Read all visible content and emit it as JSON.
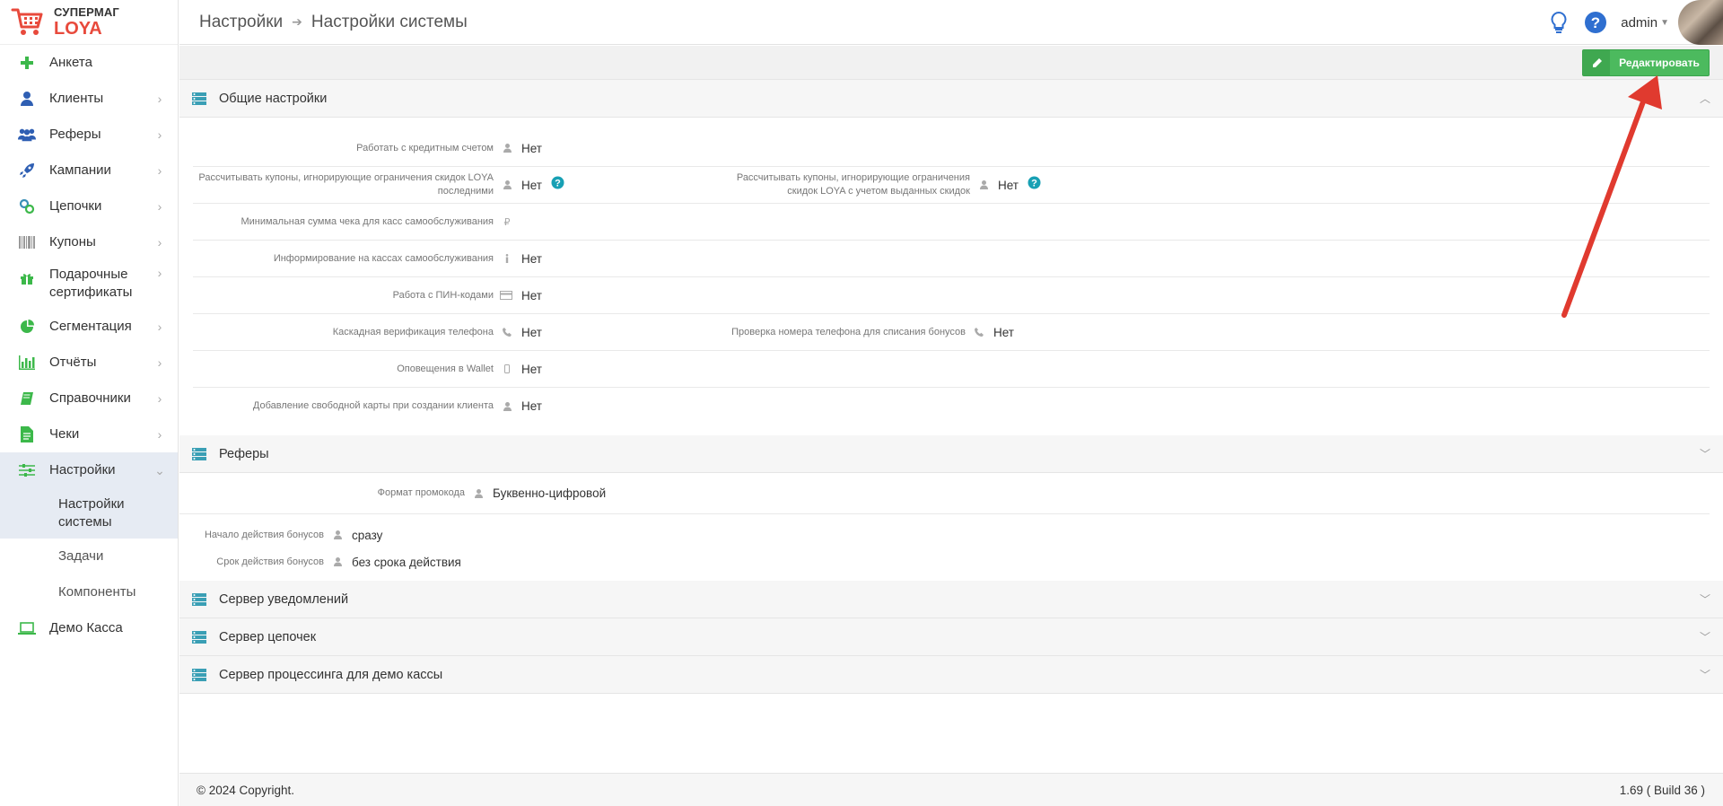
{
  "brand": {
    "line1": "СУПЕРМАГ",
    "line2": "LOYA"
  },
  "breadcrumb": {
    "section": "Настройки",
    "page": "Настройки системы"
  },
  "header": {
    "user": "admin"
  },
  "sidebar": {
    "items": [
      {
        "label": "Анкета",
        "icon": "plus-icon",
        "color": "#3cb84a"
      },
      {
        "label": "Клиенты",
        "icon": "user-icon",
        "color": "#2f5fb3"
      },
      {
        "label": "Реферы",
        "icon": "users-icon",
        "color": "#2f5fb3"
      },
      {
        "label": "Кампании",
        "icon": "rocket-icon",
        "color": "#2f5fb3"
      },
      {
        "label": "Цепочки",
        "icon": "link-icon",
        "color": "#3a8fb7"
      },
      {
        "label": "Купоны",
        "icon": "barcode-icon",
        "color": "#777777"
      },
      {
        "label": "Подарочные сертификаты",
        "icon": "gift-icon",
        "color": "#3cb84a"
      },
      {
        "label": "Сегментация",
        "icon": "pie-chart-icon",
        "color": "#3cb84a"
      },
      {
        "label": "Отчёты",
        "icon": "bar-chart-icon",
        "color": "#3cb84a"
      },
      {
        "label": "Справочники",
        "icon": "book-icon",
        "color": "#3cb84a"
      },
      {
        "label": "Чеки",
        "icon": "file-icon",
        "color": "#3cb84a"
      },
      {
        "label": "Настройки",
        "icon": "sliders-icon",
        "color": "#3cb84a"
      },
      {
        "label": "Демо Касса",
        "icon": "laptop-icon",
        "color": "#3cb84a"
      }
    ],
    "settings_sub": [
      "Настройки системы",
      "Задачи",
      "Компоненты"
    ]
  },
  "toolbar": {
    "edit_label": "Редактировать"
  },
  "sections": {
    "general": {
      "title": "Общие настройки",
      "rows": [
        {
          "label": "Работать с кредитным счетом",
          "value": "Нет"
        },
        {
          "label": "Рассчитывать купоны, игнорирующие ограничения скидок LOYA последними",
          "value": "Нет",
          "label2": "Рассчитывать купоны, игнорирующие ограничения скидок LOYA с учетом выданных скидок",
          "value2": "Нет"
        },
        {
          "label": "Минимальная сумма чека для касс самообслуживания",
          "value": ""
        },
        {
          "label": "Информирование на кассах самообслуживания",
          "value": "Нет"
        },
        {
          "label": "Работа с ПИН-кодами",
          "value": "Нет"
        },
        {
          "label": "Каскадная верификация телефона",
          "value": "Нет",
          "label2": "Проверка номера телефона для списания бонусов",
          "value2": "Нет"
        },
        {
          "label": "Оповещения в Wallet",
          "value": "Нет"
        },
        {
          "label": "Добавление свободной карты при создании клиента",
          "value": "Нет"
        }
      ]
    },
    "referrers": {
      "title": "Реферы",
      "promo_format_label": "Формат промокода",
      "promo_format_value": "Буквенно-цифровой",
      "bonus_start_label": "Начало действия бонусов",
      "bonus_start_value": "сразу",
      "bonus_term_label": "Срок действия бонусов",
      "bonus_term_value": "без срока действия"
    },
    "notify_server": {
      "title": "Сервер уведомлений"
    },
    "chain_server": {
      "title": "Сервер цепочек"
    },
    "processing_server": {
      "title": "Сервер процессинга для демо кассы"
    }
  },
  "footer": {
    "copyright": "© 2024 Copyright.",
    "version": "1.69 ( Build 36 )"
  },
  "colors": {
    "accent_green": "#4cba5e",
    "panel_icon": "#3a9fb5",
    "brand_red": "#e84a3c",
    "arrow_red": "#e03a2f"
  }
}
